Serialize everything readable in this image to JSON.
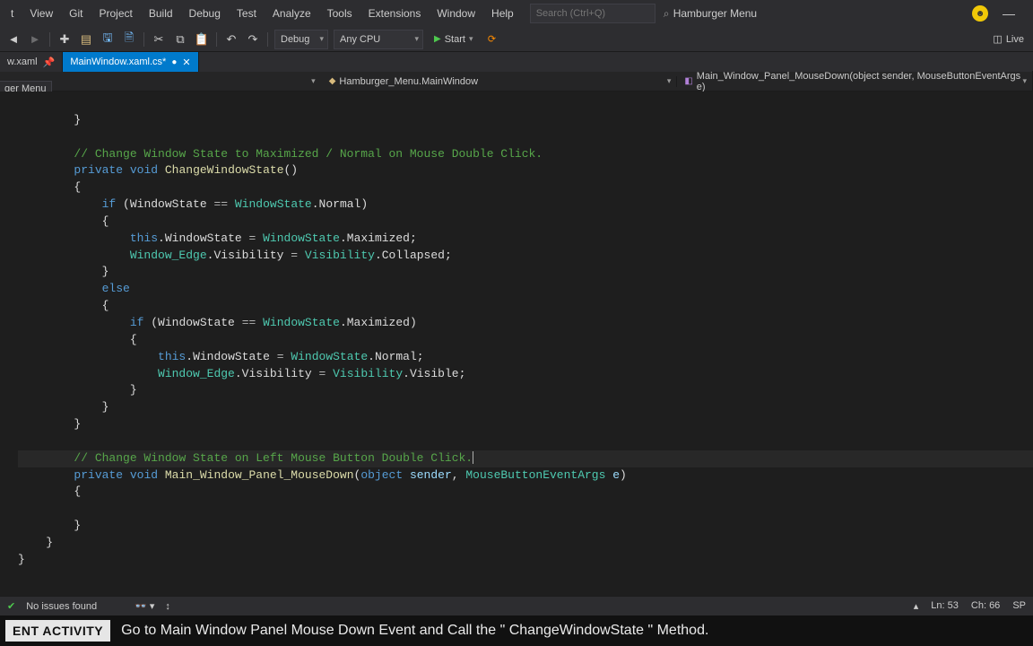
{
  "menu": {
    "items": [
      "t",
      "View",
      "Git",
      "Project",
      "Build",
      "Debug",
      "Test",
      "Analyze",
      "Tools",
      "Extensions",
      "Window",
      "Help"
    ]
  },
  "search": {
    "placeholder": "Search (Ctrl+Q)"
  },
  "solution": "Hamburger Menu",
  "toolbar": {
    "config": "Debug",
    "platform": "Any CPU",
    "start": "Start",
    "live": "Live"
  },
  "tabs": [
    {
      "label": "w.xaml",
      "dirty": false
    },
    {
      "label": "MainWindow.xaml.cs*",
      "dirty": true,
      "active": true
    }
  ],
  "nav": {
    "left": "",
    "mid_icon": "⬛",
    "mid": "Hamburger_Menu.MainWindow",
    "right_icon": "◧",
    "right": "Main_Window_Panel_MouseDown(object sender, MouseButtonEventArgs e)"
  },
  "sidepanel": "ger Menu",
  "code": {
    "c1": "// Change Window State to Maximized / Normal on Mouse Double Click.",
    "c2": "// Change Window State on Left Mouse Button Double Click.",
    "kw_private": "private",
    "kw_void": "void",
    "kw_if": "if",
    "kw_else": "else",
    "kw_this": "this",
    "m_change": "ChangeWindowState",
    "m_mouse": "Main_Window_Panel_MouseDown",
    "t_windowstate": "WindowState",
    "t_mbea": "MouseButtonEventArgs",
    "t_object": "object",
    "p_sender": "sender",
    "p_e": "e",
    "f_windowedge": "Window_Edge",
    "f_visibility": "Visibility",
    "v_normal": "Normal",
    "v_maximized": "Maximized",
    "v_collapsed": "Collapsed",
    "v_visible": "Visible"
  },
  "status": {
    "issues": "No issues found",
    "ln": "Ln: 53",
    "ch": "Ch: 66",
    "sp": "SP"
  },
  "activity": {
    "badge": "ENT ACTIVITY",
    "text": "Go to Main Window Panel Mouse Down Event and Call the \" ChangeWindowState \" Method."
  }
}
